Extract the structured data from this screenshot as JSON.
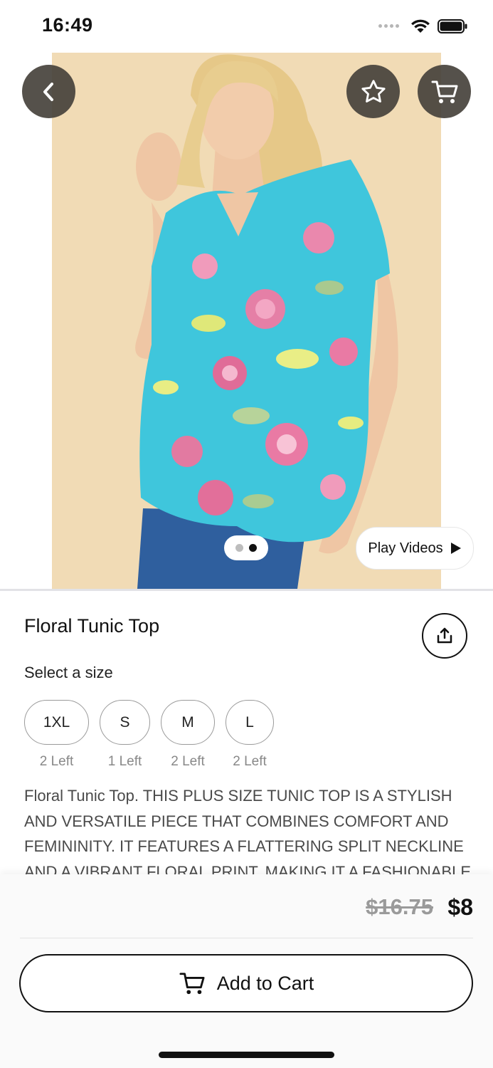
{
  "status_bar": {
    "time": "16:49",
    "icons": [
      "cellular-dots-icon",
      "wifi-icon",
      "battery-icon"
    ]
  },
  "nav": {
    "back_icon": "chevron-left-icon",
    "favorite_icon": "star-icon",
    "cart_icon": "cart-icon"
  },
  "gallery": {
    "page_count": 2,
    "current_page": 2,
    "play_videos_label": "Play Videos",
    "play_icon": "play-icon"
  },
  "product": {
    "title": "Floral Tunic Top",
    "share_icon": "share-icon",
    "size_label": "Select a size",
    "sizes": [
      {
        "label": "1XL",
        "stock": "2 Left"
      },
      {
        "label": "S",
        "stock": "1 Left"
      },
      {
        "label": "M",
        "stock": "2 Left"
      },
      {
        "label": "L",
        "stock": "2 Left"
      }
    ],
    "description": "Floral Tunic Top. THIS PLUS SIZE TUNIC TOP IS A STYLISH AND VERSATILE PIECE THAT COMBINES COMFORT AND FEMININITY. IT FEATURES A FLATTERING SPLIT NECKLINE AND A VIBRANT FLORAL PRINT, MAKING IT A FASHIONABLE"
  },
  "price": {
    "original": "$16.75",
    "current": "$8"
  },
  "cta": {
    "add_to_cart_label": "Add to Cart"
  },
  "colors": {
    "photo_background": "#f1dbb5",
    "overlay_button": "#46423c",
    "shirt": "#3fc6dc"
  }
}
